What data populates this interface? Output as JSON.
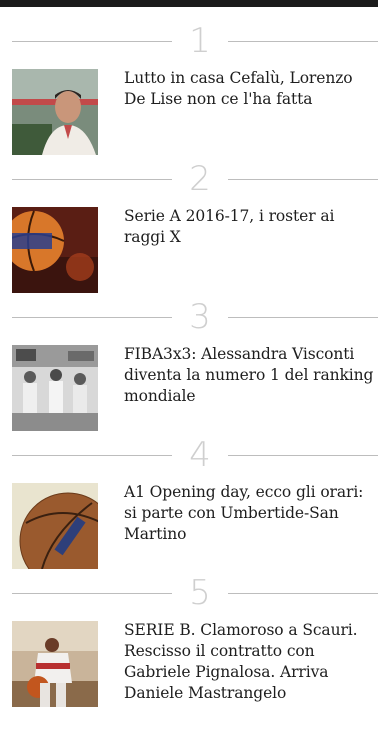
{
  "articles": [
    {
      "rank": "1",
      "title": "Lutto in casa Cefalù, Lorenzo De Lise non ce l'ha fatta",
      "thumb_icon": "player-portrait-photo"
    },
    {
      "rank": "2",
      "title": "Serie A 2016-17, i roster ai raggi X",
      "thumb_icon": "basketball-logo-photo"
    },
    {
      "rank": "3",
      "title": "FIBA3x3: Alessandra Visconti diventa la numero 1 del ranking mondiale",
      "thumb_icon": "team-photo"
    },
    {
      "rank": "4",
      "title": "A1 Opening day, ecco gli orari: si parte con Umbertide-San Martino",
      "thumb_icon": "wilson-ball-photo"
    },
    {
      "rank": "5",
      "title": "SERIE B. Clamoroso a Scauri. Rescisso il contratto con Gabriele Pignalosa. Arriva Daniele Mastrangelo",
      "thumb_icon": "player-dribbling-photo"
    }
  ]
}
